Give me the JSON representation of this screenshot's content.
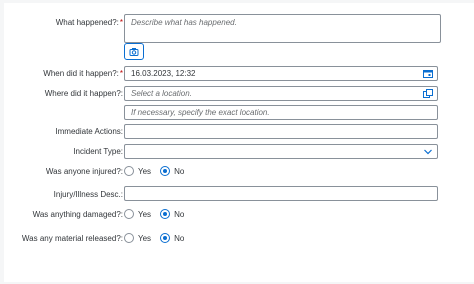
{
  "form": {
    "what_happened": {
      "label": "What happened?:",
      "required": "*",
      "placeholder": "Describe what has happened."
    },
    "when": {
      "label": "When did it happen?:",
      "required": "*",
      "value": "16.03.2023, 12:32"
    },
    "where": {
      "label": "Where did it happen?:",
      "placeholder": "Select a location."
    },
    "exact_location": {
      "placeholder": "If necessary, specify the exact location."
    },
    "immediate_actions": {
      "label": "Immediate Actions:",
      "value": ""
    },
    "incident_type": {
      "label": "Incident Type:",
      "value": ""
    },
    "injured": {
      "label": "Was anyone injured?:",
      "yes": "Yes",
      "no": "No",
      "selected": "No"
    },
    "injury_desc": {
      "label": "Injury/Illness Desc.:",
      "value": ""
    },
    "damaged": {
      "label": "Was anything damaged?:",
      "yes": "Yes",
      "no": "No",
      "selected": "No"
    },
    "material_released": {
      "label": "Was any material released?:",
      "yes": "Yes",
      "no": "No",
      "selected": "No"
    }
  },
  "icons": {
    "attach_button": "camera-icon",
    "date_picker": "calendar-icon",
    "location_picker": "value-help-icon",
    "dropdown": "chevron-down-icon"
  },
  "colors": {
    "accent": "#0a6ed1",
    "required": "#bb0000",
    "border": "#89919a"
  }
}
